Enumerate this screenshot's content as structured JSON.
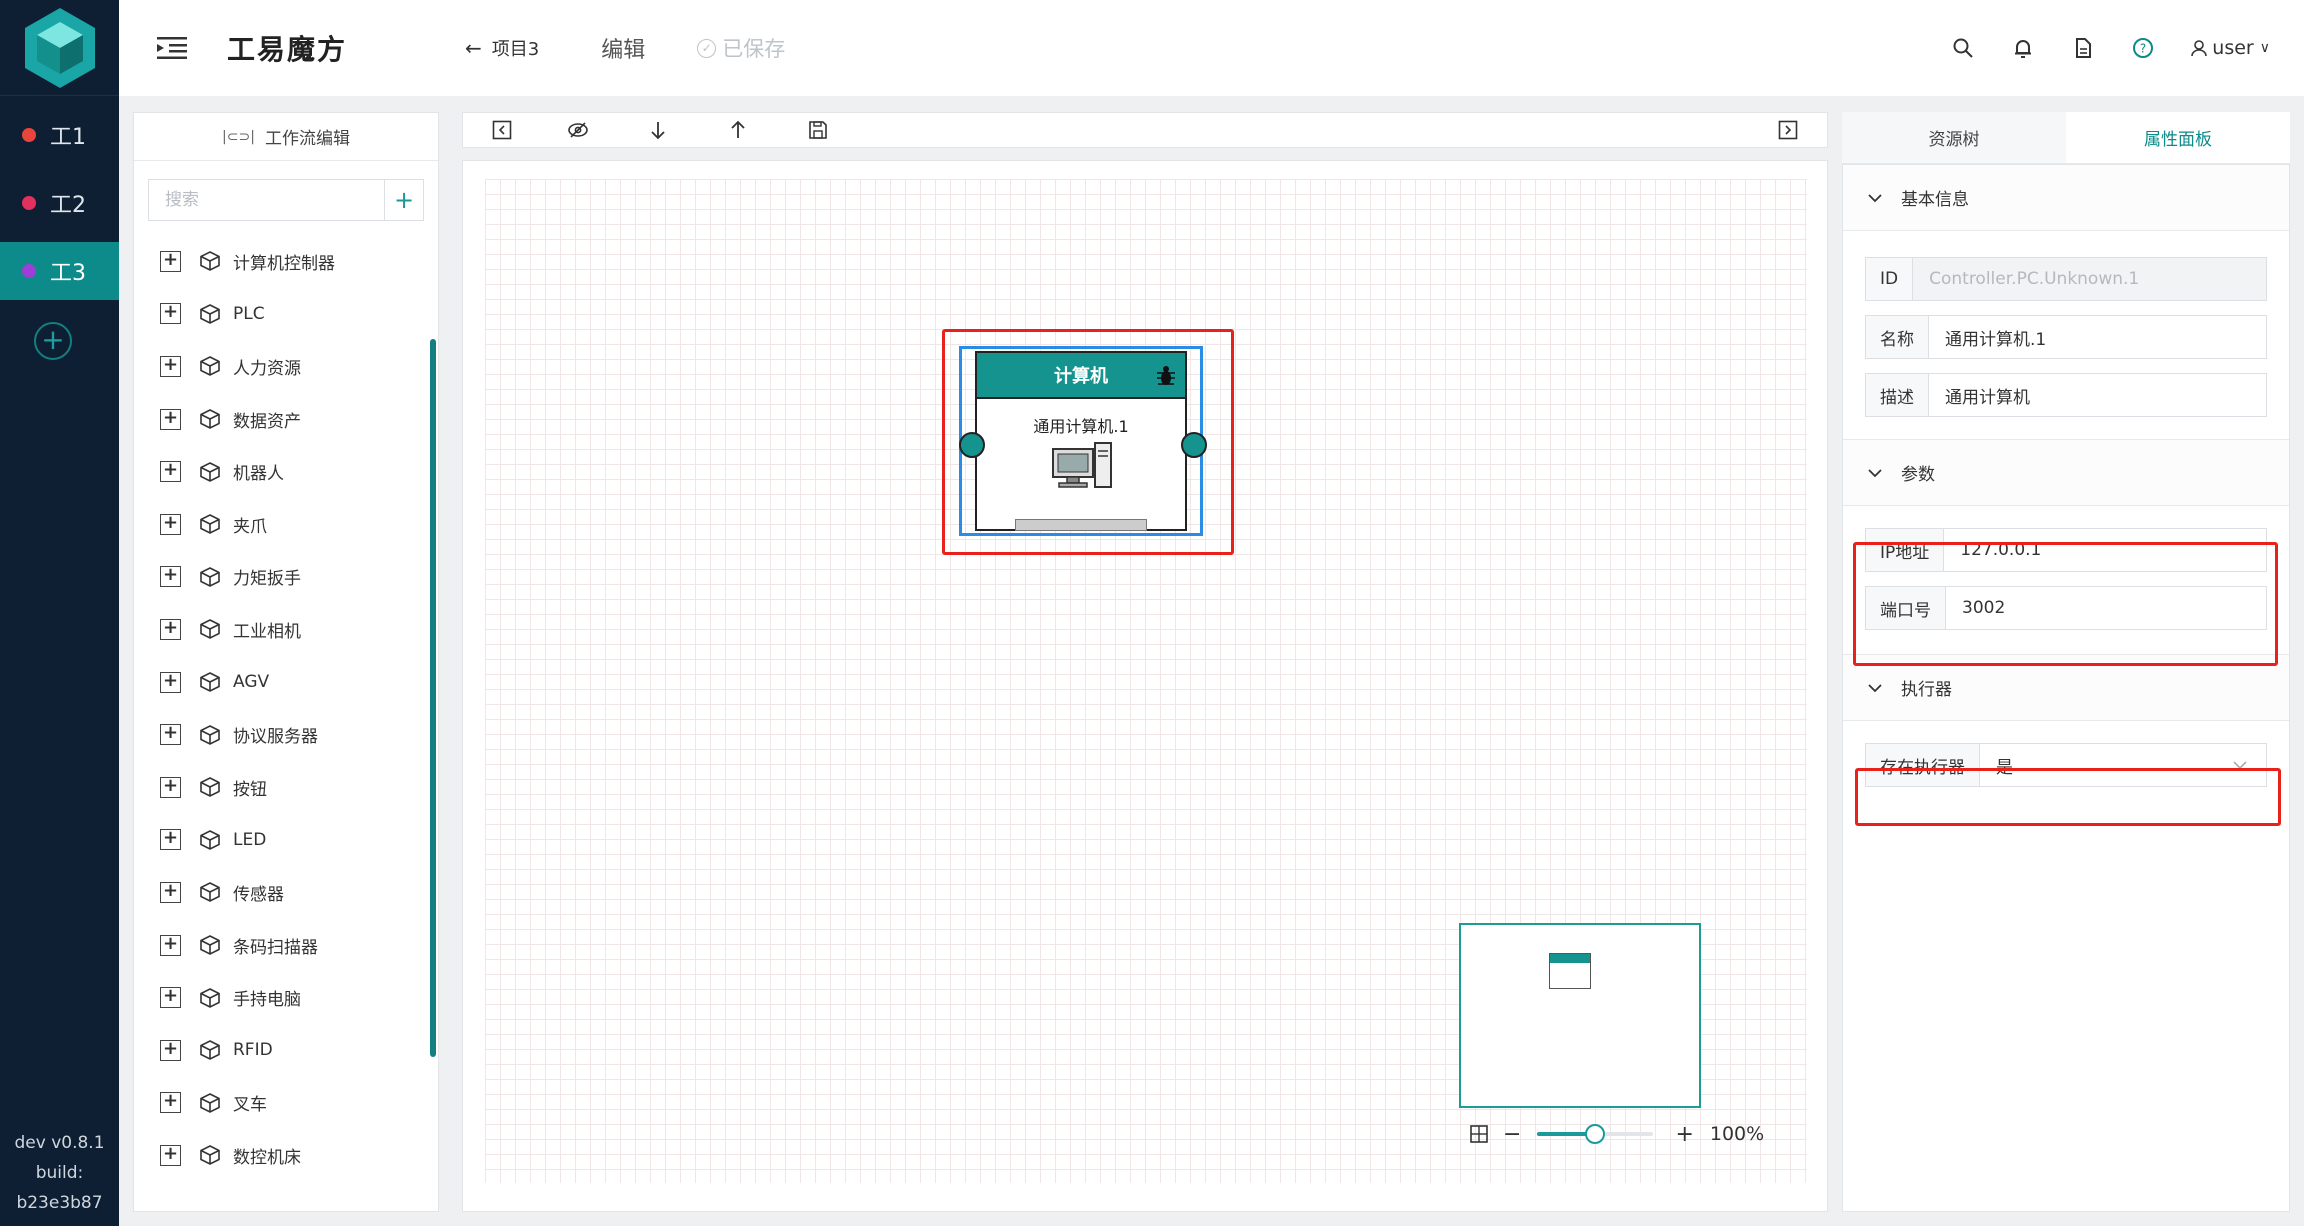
{
  "rail": {
    "workspaces": [
      {
        "label": "工1",
        "color": "#e8453c"
      },
      {
        "label": "工2",
        "color": "#e3305e"
      },
      {
        "label": "工3",
        "color": "#9b3fd6"
      }
    ],
    "version": "dev v0.8.1",
    "build_label": "build:",
    "build_hash": "b23e3b87"
  },
  "header": {
    "app_title": "工易魔方",
    "back_label": "项目3",
    "edit_label": "编辑",
    "saved_label": "已保存",
    "user": "user"
  },
  "left_panel": {
    "title": "工作流编辑",
    "search_placeholder": "搜索",
    "items": [
      "计算机控制器",
      "PLC",
      "人力资源",
      "数据资产",
      "机器人",
      "夹爪",
      "力矩扳手",
      "工业相机",
      "AGV",
      "协议服务器",
      "按钮",
      "LED",
      "传感器",
      "条码扫描器",
      "手持电脑",
      "RFID",
      "叉车",
      "数控机床"
    ]
  },
  "canvas": {
    "node": {
      "header": "计算机",
      "name": "通用计算机.1"
    },
    "zoom": "100%",
    "zoom_level": 0.5
  },
  "right_panel": {
    "tabs": [
      "资源树",
      "属性面板"
    ],
    "active_tab": 1,
    "sections": {
      "basic": {
        "title": "基本信息",
        "id_label": "ID",
        "id_value": "Controller.PC.Unknown.1",
        "name_label": "名称",
        "name_value": "通用计算机.1",
        "desc_label": "描述",
        "desc_value": "通用计算机"
      },
      "params": {
        "title": "参数",
        "ip_label": "IP地址",
        "ip_value": "127.0.0.1",
        "port_label": "端口号",
        "port_value": "3002"
      },
      "executor": {
        "title": "执行器",
        "has_executor_label": "存在执行器",
        "has_executor_value": "是"
      }
    }
  },
  "colors": {
    "accent": "#0d8a8a",
    "highlight": "#e8211a",
    "rail_bg": "#0f1f33",
    "selection": "#2b8ce6"
  }
}
